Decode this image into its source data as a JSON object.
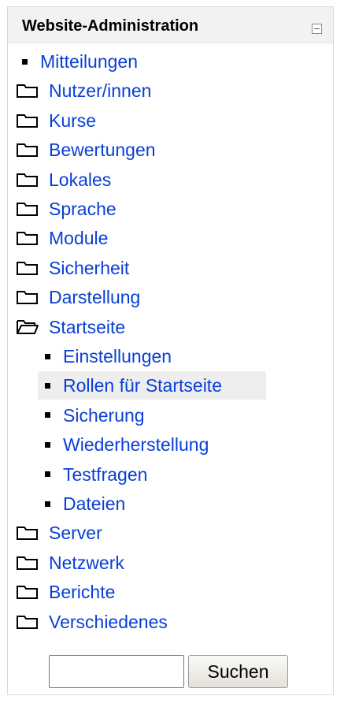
{
  "block": {
    "title": "Website-Administration",
    "collapse_icon": "minus-box-icon"
  },
  "tree": [
    {
      "label": "Mitteilungen",
      "icon": "bullet-icon",
      "level": 0,
      "expanded": false
    },
    {
      "label": "Nutzer/innen",
      "icon": "folder-closed-icon",
      "level": 0,
      "expanded": false
    },
    {
      "label": "Kurse",
      "icon": "folder-closed-icon",
      "level": 0,
      "expanded": false
    },
    {
      "label": "Bewertungen",
      "icon": "folder-closed-icon",
      "level": 0,
      "expanded": false
    },
    {
      "label": "Lokales",
      "icon": "folder-closed-icon",
      "level": 0,
      "expanded": false
    },
    {
      "label": "Sprache",
      "icon": "folder-closed-icon",
      "level": 0,
      "expanded": false
    },
    {
      "label": "Module",
      "icon": "folder-closed-icon",
      "level": 0,
      "expanded": false
    },
    {
      "label": "Sicherheit",
      "icon": "folder-closed-icon",
      "level": 0,
      "expanded": false
    },
    {
      "label": "Darstellung",
      "icon": "folder-closed-icon",
      "level": 0,
      "expanded": false
    },
    {
      "label": "Startseite",
      "icon": "folder-open-icon",
      "level": 0,
      "expanded": true
    },
    {
      "label": "Einstellungen",
      "icon": "bullet-icon",
      "level": 1
    },
    {
      "label": "Rollen für Startseite",
      "icon": "bullet-icon",
      "level": 1,
      "highlighted": true
    },
    {
      "label": "Sicherung",
      "icon": "bullet-icon",
      "level": 1
    },
    {
      "label": "Wiederherstellung",
      "icon": "bullet-icon",
      "level": 1
    },
    {
      "label": "Testfragen",
      "icon": "bullet-icon",
      "level": 1
    },
    {
      "label": "Dateien",
      "icon": "bullet-icon",
      "level": 1
    },
    {
      "label": "Server",
      "icon": "folder-closed-icon",
      "level": 0,
      "expanded": false
    },
    {
      "label": "Netzwerk",
      "icon": "folder-closed-icon",
      "level": 0,
      "expanded": false
    },
    {
      "label": "Berichte",
      "icon": "folder-closed-icon",
      "level": 0,
      "expanded": false
    },
    {
      "label": "Verschiedenes",
      "icon": "folder-closed-icon",
      "level": 0,
      "expanded": false
    }
  ],
  "search": {
    "value": "",
    "placeholder": "",
    "button_label": "Suchen"
  },
  "colors": {
    "link": "#0a3fd6",
    "header_bg": "#f2f2f2",
    "highlight_bg": "#eeeeee"
  }
}
